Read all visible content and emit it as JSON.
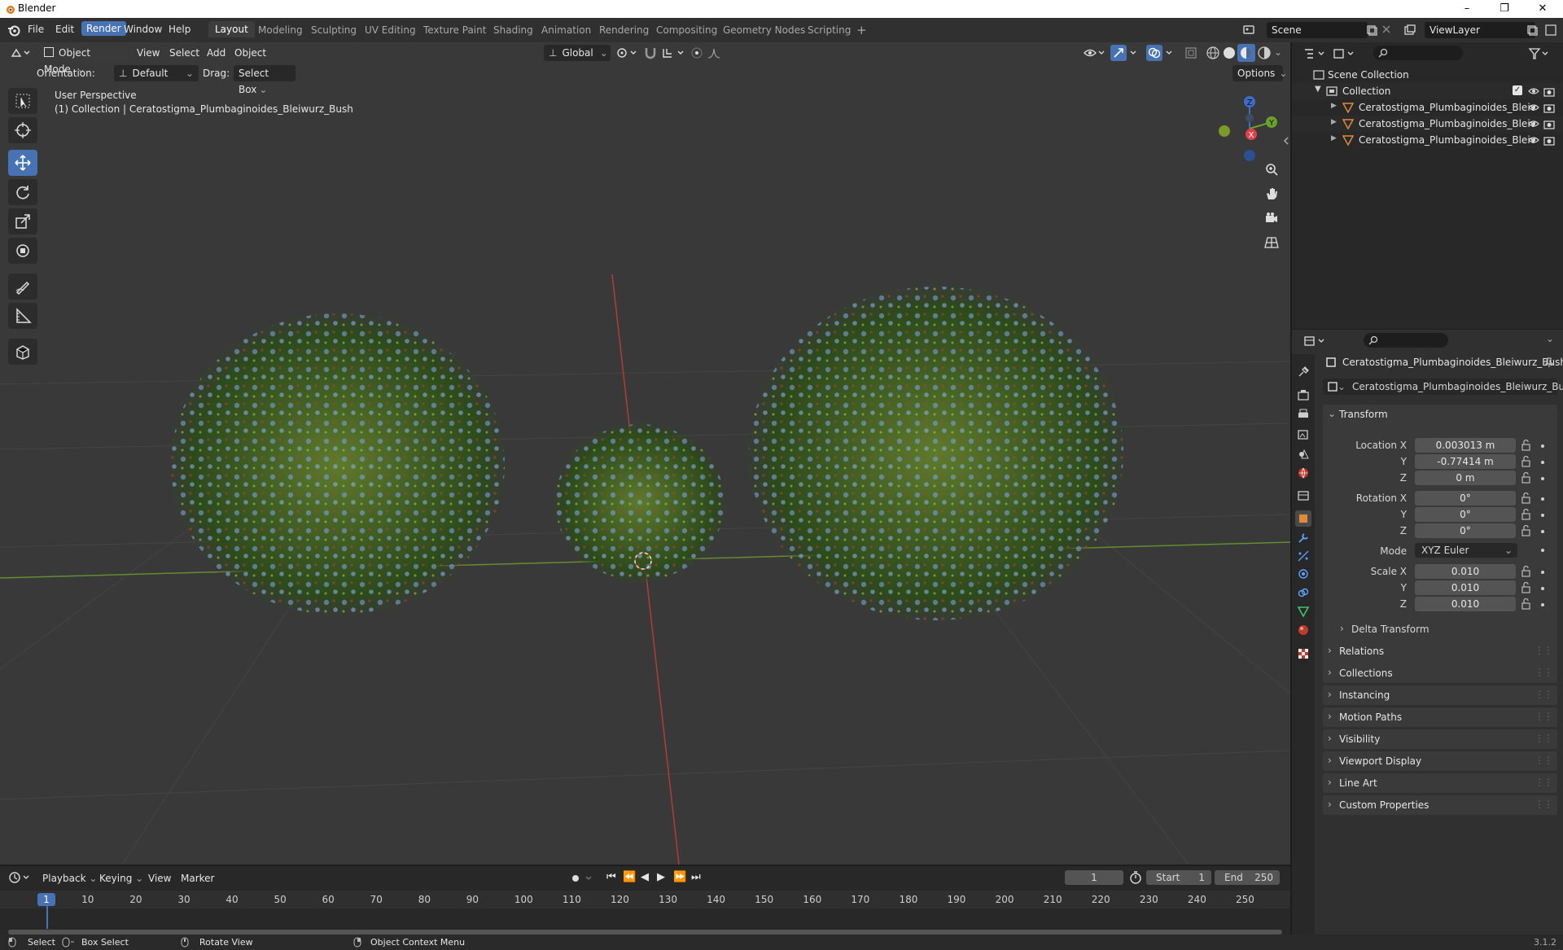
{
  "window": {
    "title": "Blender",
    "minimize": "–",
    "maximize": "❐",
    "close": "✕"
  },
  "menubar": {
    "menus": [
      "File",
      "Edit",
      "Render",
      "Window",
      "Help"
    ],
    "active_menu": "Render",
    "workspaces": [
      "Layout",
      "Modeling",
      "Sculpting",
      "UV Editing",
      "Texture Paint",
      "Shading",
      "Animation",
      "Rendering",
      "Compositing",
      "Geometry Nodes",
      "Scripting"
    ],
    "active_workspace": "Layout",
    "add_tab": "+",
    "scene": "Scene",
    "view_layer": "ViewLayer"
  },
  "viewport": {
    "mode": "Object Mode",
    "menus": [
      "View",
      "Select",
      "Add",
      "Object"
    ],
    "transform_orientation": "Global",
    "orientation_label": "Orientation:",
    "orientation_value": "Default",
    "drag_label": "Drag:",
    "drag_value": "Select Box",
    "options": "Options",
    "overlay_line1": "User Perspective",
    "overlay_line2": "(1) Collection | Ceratostigma_Plumbaginoides_Bleiwurz_Bush",
    "gizmo": {
      "x": "X",
      "y": "Y",
      "z": "Z"
    },
    "accent": "#4772b3"
  },
  "timeline": {
    "menus": [
      "Playback",
      "Keying",
      "View",
      "Marker"
    ],
    "current_frame": "1",
    "start_label": "Start",
    "start": "1",
    "end_label": "End",
    "end": "250",
    "ruler_current": "1",
    "ticks": [
      "10",
      "20",
      "30",
      "40",
      "50",
      "60",
      "70",
      "80",
      "90",
      "100",
      "110",
      "120",
      "130",
      "140",
      "150",
      "160",
      "170",
      "180",
      "190",
      "200",
      "210",
      "220",
      "230",
      "240",
      "250"
    ]
  },
  "statusbar": {
    "items": [
      "Select",
      "Box Select",
      "Rotate View",
      "Object Context Menu"
    ],
    "version": "3.1.2"
  },
  "outliner": {
    "scene_collection": "Scene Collection",
    "collection": "Collection",
    "objects": [
      "Ceratostigma_Plumbaginoides_Bleiv",
      "Ceratostigma_Plumbaginoides_Bleiv",
      "Ceratostigma_Plumbaginoides_Bleiv"
    ]
  },
  "properties": {
    "object_name": "Ceratostigma_Plumbaginoides_Bleiwurz_Bush",
    "object_field": "Ceratostigma_Plumbaginoides_Bleiwurz_Bush",
    "transform_title": "Transform",
    "location_label": "Location X",
    "location": [
      "0.003013 m",
      "-0.77414 m",
      "0 m"
    ],
    "rotation_label": "Rotation X",
    "rotation": [
      "0°",
      "0°",
      "0°"
    ],
    "mode_label": "Mode",
    "mode_value": "XYZ Euler",
    "scale_label": "Scale X",
    "scale": [
      "0.010",
      "0.010",
      "0.010"
    ],
    "y_label": "Y",
    "z_label": "Z",
    "delta_transform": "Delta Transform",
    "panels": [
      "Relations",
      "Collections",
      "Instancing",
      "Motion Paths",
      "Visibility",
      "Viewport Display",
      "Line Art",
      "Custom Properties"
    ]
  }
}
